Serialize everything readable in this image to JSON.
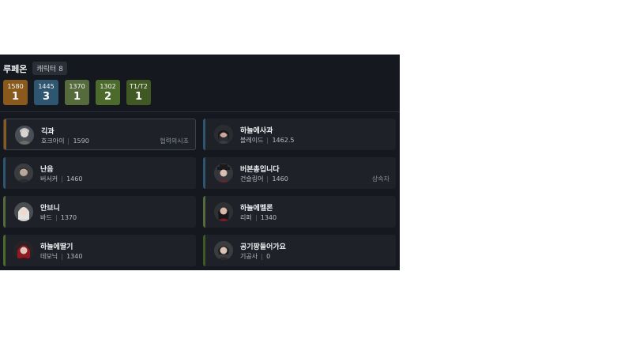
{
  "header": {
    "server": "루페온",
    "character_count": "캐릭터 8"
  },
  "tiers": [
    {
      "level": "1580",
      "count": "1",
      "color": "#8a5a1c"
    },
    {
      "level": "1445",
      "count": "3",
      "color": "#2f5670"
    },
    {
      "level": "1370",
      "count": "1",
      "color": "#566b3c"
    },
    {
      "level": "1302",
      "count": "2",
      "color": "#4c6a2c"
    },
    {
      "level": "T1/T2",
      "count": "1",
      "color": "#3f5824"
    }
  ],
  "characters": [
    {
      "name": "긱과",
      "class": "호크아이",
      "level": "1590",
      "tag": "협력의시초",
      "stripe": "#8a5a1c",
      "selected": true
    },
    {
      "name": "하늘에사과",
      "class": "블레이드",
      "level": "1462.5",
      "tag": "",
      "stripe": "#2f5670"
    },
    {
      "name": "난음",
      "class": "버서커",
      "level": "1460",
      "tag": "",
      "stripe": "#2f5670"
    },
    {
      "name": "버본총입니다",
      "class": "건슬링어",
      "level": "1460",
      "tag": "상속자",
      "stripe": "#2f5670"
    },
    {
      "name": "안브니",
      "class": "바드",
      "level": "1370",
      "tag": "",
      "stripe": "#566b3c"
    },
    {
      "name": "하늘에멜론",
      "class": "리퍼",
      "level": "1340",
      "tag": "",
      "stripe": "#566b3c"
    },
    {
      "name": "하늘에딸기",
      "class": "데모닉",
      "level": "1340",
      "tag": "",
      "stripe": "#4c6a2c"
    },
    {
      "name": "공기팡들어가요",
      "class": "기공사",
      "level": "0",
      "tag": "",
      "stripe": "#3f5824"
    }
  ]
}
